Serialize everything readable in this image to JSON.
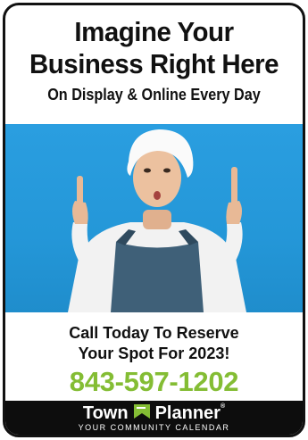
{
  "ad": {
    "headline_line1": "Imagine Your",
    "headline_line2": "Business Right Here",
    "subheadline": "On Display & Online Every Day",
    "cta_line1": "Call Today To Reserve",
    "cta_line2": "Your Spot For 2023!",
    "phone": "843-597-1202"
  },
  "brand": {
    "word1": "Town",
    "word2": "Planner",
    "registered": "®",
    "tagline": "YOUR COMMUNITY CALENDAR"
  },
  "colors": {
    "phone_green": "#84bd34",
    "photo_blue": "#2497d8",
    "footer_bg": "#0d0d0d",
    "flag_green": "#84bd34",
    "border": "#111111"
  },
  "icons": {
    "brand_logo": "flag-icon"
  }
}
